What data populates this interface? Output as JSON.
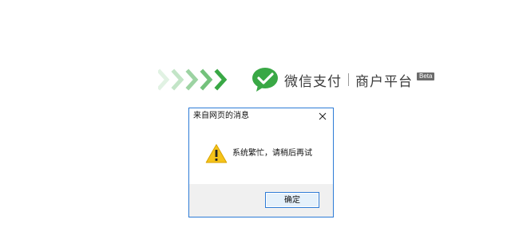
{
  "brand": {
    "name": "微信支付",
    "subtitle": "商户平台",
    "badge": "Beta"
  },
  "dialog": {
    "title": "来自网页的消息",
    "message": "系统繁忙，请稍后再试",
    "ok_label": "确定"
  },
  "icons": {
    "decoration": "chevron-arrows-icon",
    "logo": "wechat-pay-logo-icon",
    "close": "close-icon",
    "warning": "warning-icon"
  },
  "colors": {
    "brand_green": "#39a845",
    "dialog_border": "#2d7bd6",
    "warning_yellow": "#f5c31a"
  }
}
